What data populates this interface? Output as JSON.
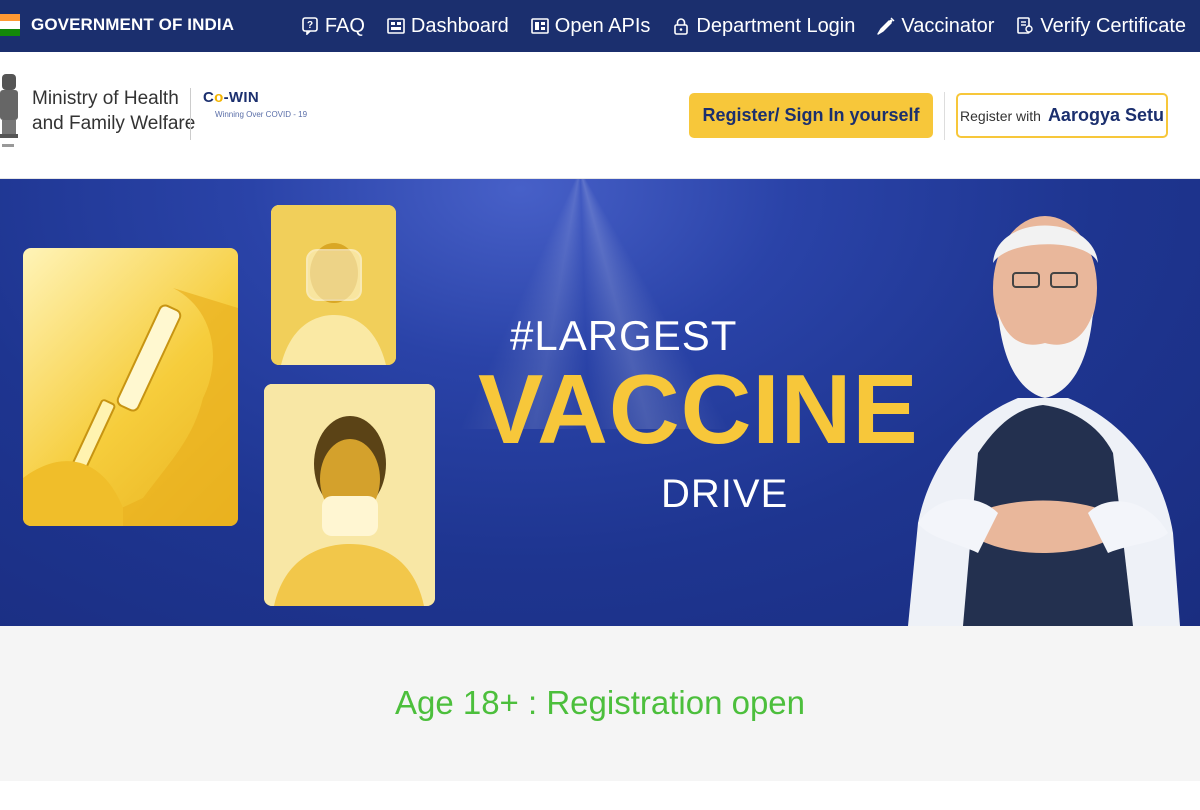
{
  "topbar": {
    "government_label": "GOVERNMENT OF INDIA",
    "nav": [
      {
        "label": "FAQ",
        "icon": "faq-icon"
      },
      {
        "label": "Dashboard",
        "icon": "dashboard-icon"
      },
      {
        "label": "Open APIs",
        "icon": "api-icon"
      },
      {
        "label": "Department Login",
        "icon": "lock-icon"
      },
      {
        "label": "Vaccinator",
        "icon": "syringe-icon"
      },
      {
        "label": "Verify Certificate",
        "icon": "certificate-icon"
      }
    ],
    "flag_colors": [
      "#ff9933",
      "#ffffff",
      "#138808"
    ],
    "background": "#1b2f6e"
  },
  "header": {
    "ministry_line1": "Ministry of Health",
    "ministry_line2": "and Family Welfare",
    "cowin_co": "C",
    "cowin_o": "o",
    "cowin_win": "-WIN",
    "cowin_tagline": "Winning Over COVID - 19",
    "register_button": "Register/ Sign In yourself",
    "aarogya_prefix": "Register with",
    "aarogya_name": "Aarogya Setu",
    "accent": "#f7c73a"
  },
  "banner": {
    "line1": "#LARGEST",
    "line2": "VACCINE",
    "line3": "DRIVE",
    "highlight_color": "#f7c73a"
  },
  "status": {
    "text": "Age 18+ : Registration open",
    "color": "#4cbf3c"
  }
}
